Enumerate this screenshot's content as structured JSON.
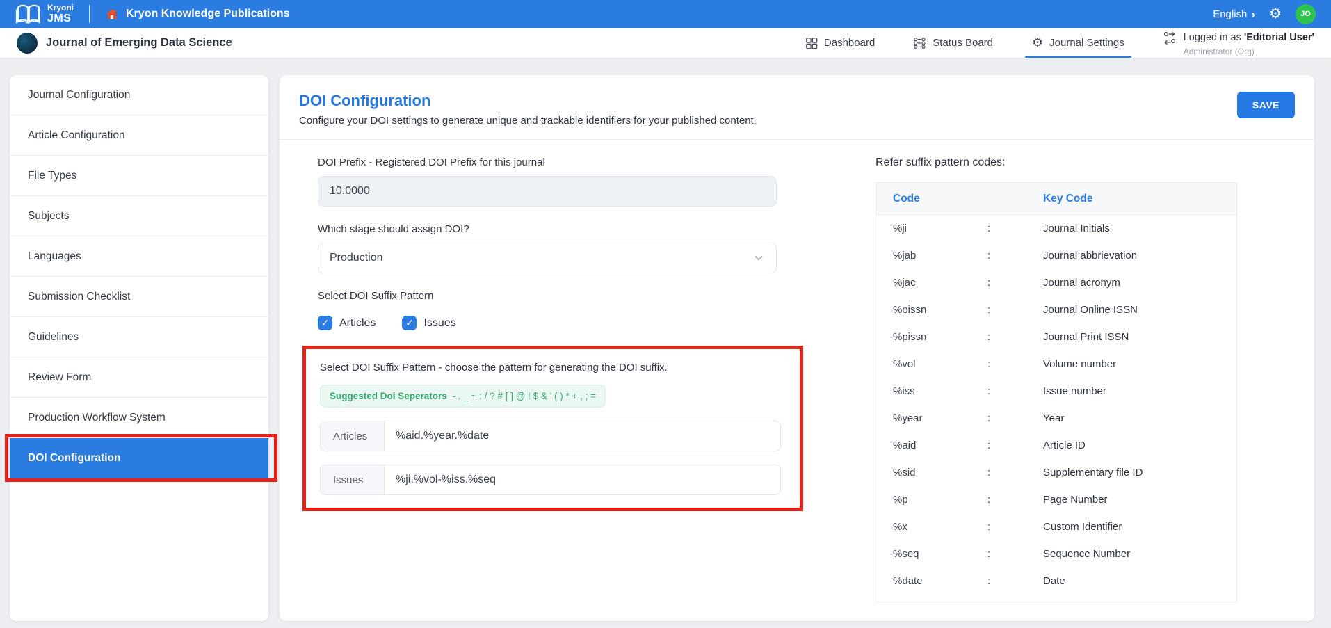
{
  "topbar": {
    "brand_line1": "Kryoni",
    "brand_line2": "JMS",
    "publisher": "Kryon Knowledge Publications",
    "language": "English",
    "avatar_initials": "JO"
  },
  "header": {
    "journal_title": "Journal of Emerging Data Science",
    "nav": [
      {
        "label": "Dashboard",
        "active": false
      },
      {
        "label": "Status Board",
        "active": false
      },
      {
        "label": "Journal Settings",
        "active": true
      }
    ],
    "user": {
      "logged_in_prefix": "Logged in as",
      "user_name": "'Editorial User'",
      "role": "Administrator (Org)"
    }
  },
  "sidebar": {
    "items": [
      {
        "label": "Journal Configuration",
        "active": false
      },
      {
        "label": "Article Configuration",
        "active": false
      },
      {
        "label": "File Types",
        "active": false
      },
      {
        "label": "Subjects",
        "active": false
      },
      {
        "label": "Languages",
        "active": false
      },
      {
        "label": "Submission Checklist",
        "active": false
      },
      {
        "label": "Guidelines",
        "active": false
      },
      {
        "label": "Review Form",
        "active": false
      },
      {
        "label": "Production Workflow System",
        "active": false
      },
      {
        "label": "DOI Configuration",
        "active": true
      }
    ]
  },
  "main": {
    "title": "DOI Configuration",
    "subtitle": "Configure your DOI settings to generate unique and trackable identifiers for your published content.",
    "save_label": "SAVE",
    "form": {
      "prefix_label": "DOI Prefix - Registered DOI Prefix for this journal",
      "prefix_value": "10.0000",
      "stage_label": "Which stage should assign DOI?",
      "stage_value": "Production",
      "suffix_label": "Select DOI Suffix Pattern",
      "suffix_options": [
        {
          "label": "Articles",
          "checked": true
        },
        {
          "label": "Issues",
          "checked": true
        }
      ],
      "suffix_section": {
        "description": "Select DOI Suffix Pattern - choose the pattern for generating the DOI suffix.",
        "separators_label": "Suggested Doi Seperators",
        "separators": "- . _ ~ : / ? # [ ] @ ! $ & ' ( ) * + , ; =",
        "patterns": [
          {
            "label": "Articles",
            "value": "%aid.%year.%date"
          },
          {
            "label": "Issues",
            "value": "%ji.%vol-%iss.%seq"
          }
        ]
      }
    },
    "codes_panel": {
      "title": "Refer suffix pattern codes:",
      "col_code": "Code",
      "col_key": "Key Code",
      "rows": [
        [
          "%ji",
          ":",
          "Journal Initials"
        ],
        [
          "%jab",
          ":",
          "Journal abbrievation"
        ],
        [
          "%jac",
          ":",
          "Journal acronym"
        ],
        [
          "%oissn",
          ":",
          "Journal Online ISSN"
        ],
        [
          "%pissn",
          ":",
          "Journal Print ISSN"
        ],
        [
          "%vol",
          ":",
          "Volume number"
        ],
        [
          "%iss",
          ":",
          "Issue number"
        ],
        [
          "%year",
          ":",
          "Year"
        ],
        [
          "%aid",
          ":",
          "Article ID"
        ],
        [
          "%sid",
          ":",
          "Supplementary file ID"
        ],
        [
          "%p",
          ":",
          "Page Number"
        ],
        [
          "%x",
          ":",
          "Custom Identifier"
        ],
        [
          "%seq",
          ":",
          "Sequence Number"
        ],
        [
          "%date",
          ":",
          "Date"
        ]
      ]
    }
  },
  "colors": {
    "accent_blue": "#2b7ce1",
    "title_blue": "#2679e2",
    "annotation_red": "#e2231a",
    "separator_green": "#36a872",
    "avatar_green": "#2ec24f"
  }
}
